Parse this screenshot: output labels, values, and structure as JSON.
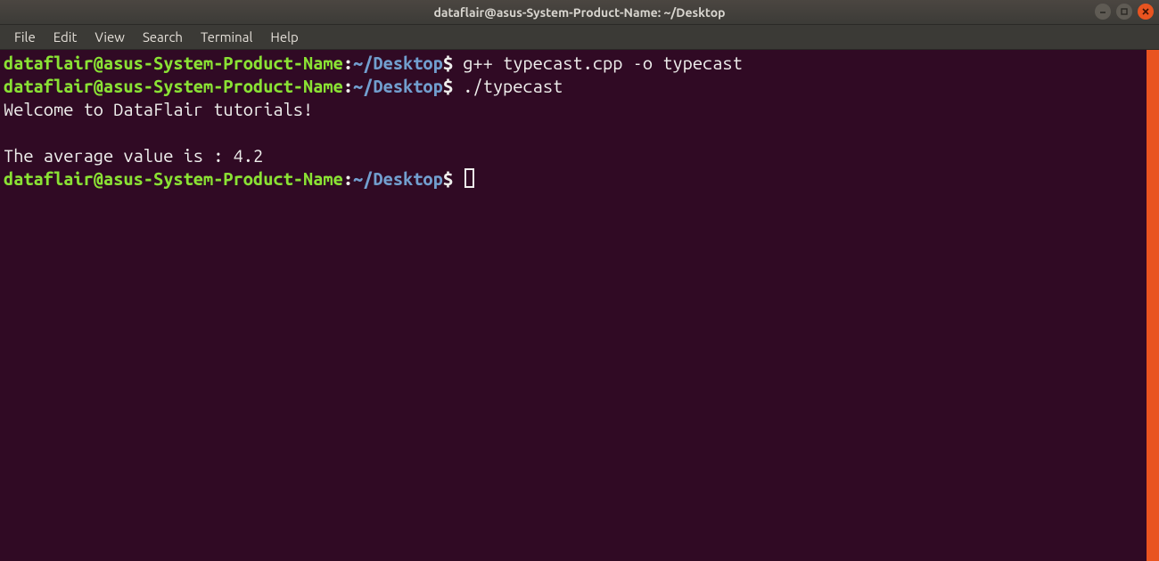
{
  "titlebar": {
    "title": "dataflair@asus-System-Product-Name: ~/Desktop"
  },
  "menubar": {
    "items": [
      "File",
      "Edit",
      "View",
      "Search",
      "Terminal",
      "Help"
    ]
  },
  "prompt": {
    "user_host": "dataflair@asus-System-Product-Name",
    "colon": ":",
    "path": "~/Desktop",
    "dollar": "$"
  },
  "lines": {
    "cmd1": " g++ typecast.cpp -o typecast",
    "cmd2": " ./typecast",
    "out1": "Welcome to DataFlair tutorials!",
    "blank": "",
    "out2": "The average value is : 4.2",
    "cmd3": " "
  }
}
